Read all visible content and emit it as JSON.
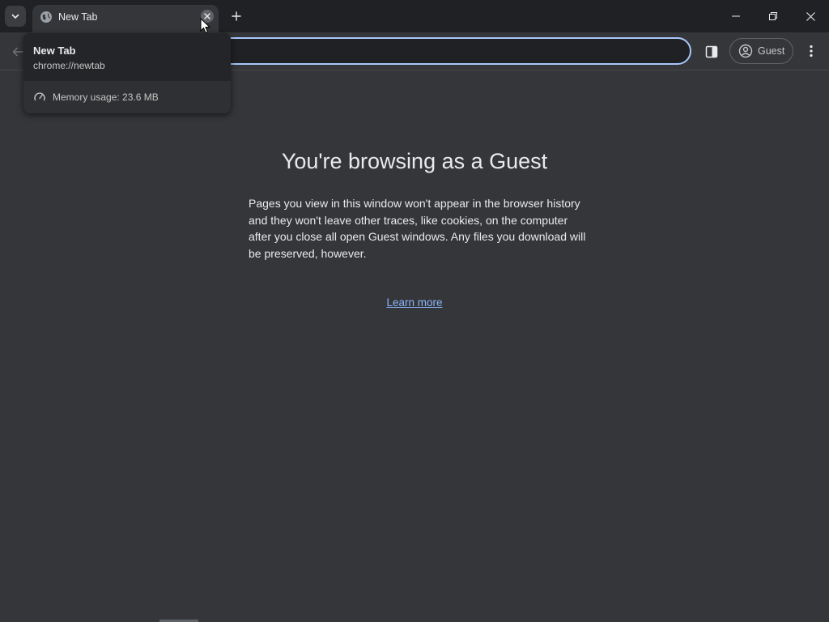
{
  "tab": {
    "title": "New Tab"
  },
  "hovercard": {
    "title": "New Tab",
    "url": "chrome://newtab",
    "memory": "Memory usage: 23.6 MB"
  },
  "toolbar": {
    "omnibox_value": "",
    "profile_label": "Guest"
  },
  "content": {
    "heading": "You're browsing as a Guest",
    "description": "Pages you view in this window won't appear in the browser history and they won't leave other traces, like cookies, on the computer after you close all open Guest windows. Any files you download will be preserved, however.",
    "learn_more": "Learn more"
  },
  "colors": {
    "background": "#35363a",
    "tabstrip": "#202124",
    "accent_link": "#8ab4f8",
    "omnibox_border": "#a8c7fa"
  },
  "icons": [
    "chevron-down-icon",
    "globe-icon",
    "close-icon",
    "plus-icon",
    "minimize-icon",
    "restore-icon",
    "back-arrow-icon",
    "side-panel-icon",
    "account-icon",
    "more-vert-icon",
    "gauge-icon"
  ]
}
